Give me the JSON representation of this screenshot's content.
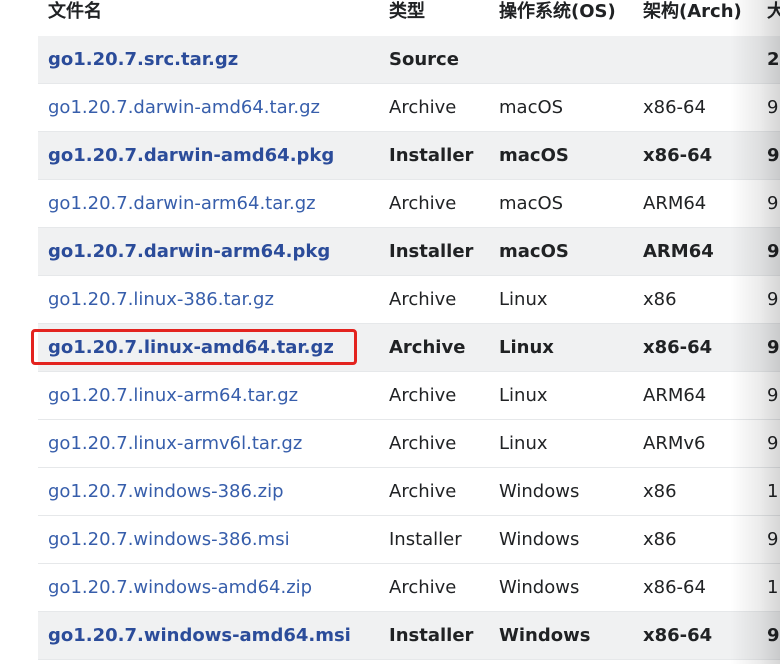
{
  "table": {
    "headers": [
      "文件名",
      "类型",
      "操作系统(OS)",
      "架构(Arch)",
      "大"
    ],
    "rows": [
      {
        "featured": true,
        "file": "go1.20.7.src.tar.gz",
        "kind": "Source",
        "os": "",
        "arch": "",
        "size": "2"
      },
      {
        "featured": false,
        "file": "go1.20.7.darwin-amd64.tar.gz",
        "kind": "Archive",
        "os": "macOS",
        "arch": "x86-64",
        "size": "9"
      },
      {
        "featured": true,
        "file": "go1.20.7.darwin-amd64.pkg",
        "kind": "Installer",
        "os": "macOS",
        "arch": "x86-64",
        "size": "9"
      },
      {
        "featured": false,
        "file": "go1.20.7.darwin-arm64.tar.gz",
        "kind": "Archive",
        "os": "macOS",
        "arch": "ARM64",
        "size": "9"
      },
      {
        "featured": true,
        "file": "go1.20.7.darwin-arm64.pkg",
        "kind": "Installer",
        "os": "macOS",
        "arch": "ARM64",
        "size": "9"
      },
      {
        "featured": false,
        "file": "go1.20.7.linux-386.tar.gz",
        "kind": "Archive",
        "os": "Linux",
        "arch": "x86",
        "size": "9"
      },
      {
        "featured": true,
        "file": "go1.20.7.linux-amd64.tar.gz",
        "kind": "Archive",
        "os": "Linux",
        "arch": "x86-64",
        "size": "9",
        "highlighted": true
      },
      {
        "featured": false,
        "file": "go1.20.7.linux-arm64.tar.gz",
        "kind": "Archive",
        "os": "Linux",
        "arch": "ARM64",
        "size": "9"
      },
      {
        "featured": false,
        "file": "go1.20.7.linux-armv6l.tar.gz",
        "kind": "Archive",
        "os": "Linux",
        "arch": "ARMv6",
        "size": "9"
      },
      {
        "featured": false,
        "file": "go1.20.7.windows-386.zip",
        "kind": "Archive",
        "os": "Windows",
        "arch": "x86",
        "size": "1"
      },
      {
        "featured": false,
        "file": "go1.20.7.windows-386.msi",
        "kind": "Installer",
        "os": "Windows",
        "arch": "x86",
        "size": "9"
      },
      {
        "featured": false,
        "file": "go1.20.7.windows-amd64.zip",
        "kind": "Archive",
        "os": "Windows",
        "arch": "x86-64",
        "size": "1"
      },
      {
        "featured": true,
        "file": "go1.20.7.windows-amd64.msi",
        "kind": "Installer",
        "os": "Windows",
        "arch": "x86-64",
        "size": "9"
      }
    ]
  },
  "colors": {
    "link": "#375eab",
    "featured_row_bg": "#f0f1f2",
    "highlight_border": "#e3231f"
  }
}
